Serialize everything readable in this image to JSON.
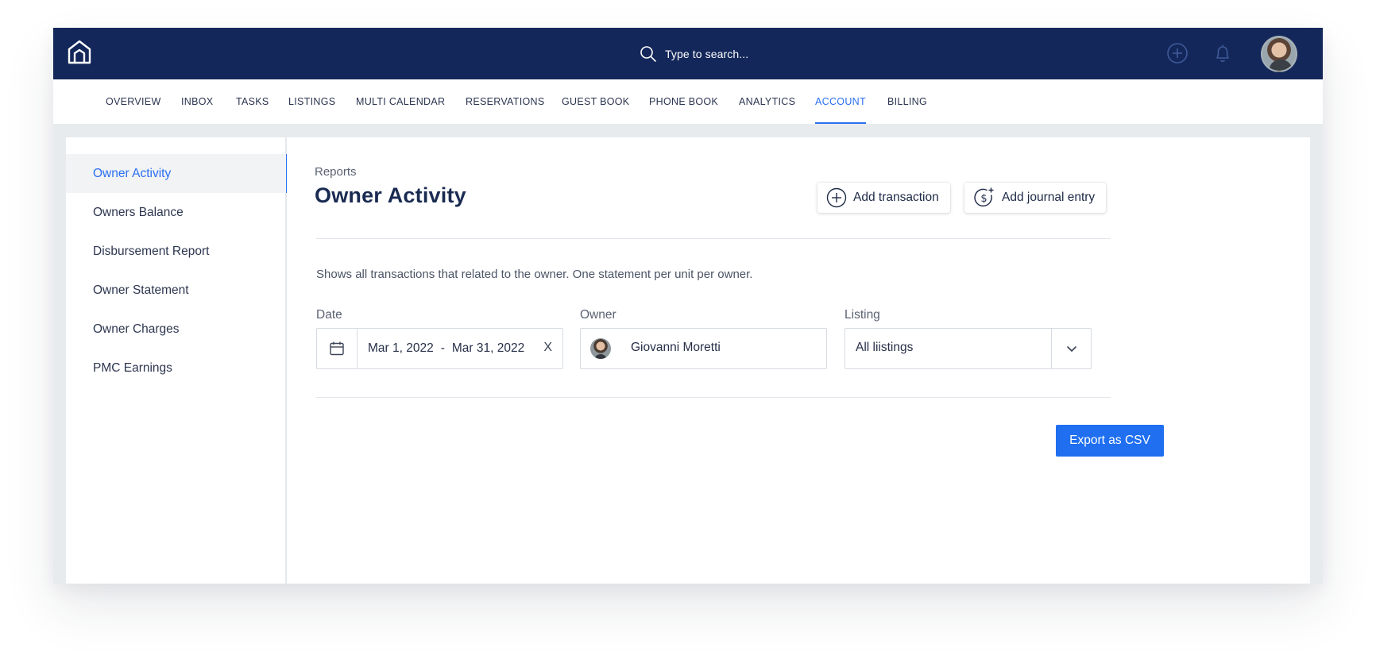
{
  "topbar": {
    "logo_icon": "house-logo-icon",
    "search_placeholder": "Type to search...",
    "search_icon": "search-icon",
    "add_icon": "plus-circle-icon",
    "notifications_icon": "bell-icon",
    "avatar_icon": "user-avatar"
  },
  "nav": {
    "items": [
      {
        "label": "OVERVIEW"
      },
      {
        "label": "INBOX"
      },
      {
        "label": "TASKS"
      },
      {
        "label": "LISTINGS"
      },
      {
        "label": "MULTI CALENDAR"
      },
      {
        "label": "RESERVATIONS"
      },
      {
        "label": "GUEST BOOK"
      },
      {
        "label": "PHONE BOOK"
      },
      {
        "label": "ANALYTICS"
      },
      {
        "label": "ACCOUNT"
      },
      {
        "label": "BILLING"
      }
    ],
    "active": "ACCOUNT"
  },
  "sidebar": {
    "items": [
      {
        "label": "Owner Activity"
      },
      {
        "label": "Owners Balance"
      },
      {
        "label": "Disbursement Report"
      },
      {
        "label": "Owner Statement"
      },
      {
        "label": "Owner Charges"
      },
      {
        "label": "PMC Earnings"
      }
    ],
    "active": "Owner Activity"
  },
  "main": {
    "breadcrumb": "Reports",
    "title": "Owner Activity",
    "actions": {
      "add_transaction": "Add transaction",
      "add_journal_entry": "Add journal entry"
    },
    "description": "Shows all transactions that related to the owner. One statement per unit per owner.",
    "filters": {
      "date": {
        "label": "Date",
        "start": "Mar 1, 2022",
        "separator": "-",
        "end": "Mar 31, 2022",
        "clear": "X"
      },
      "owner": {
        "label": "Owner",
        "value": "Giovanni Moretti"
      },
      "listing": {
        "label": "Listing",
        "value": "All liistings"
      }
    },
    "export_label": "Export as CSV"
  },
  "colors": {
    "topbar": "#13275a",
    "accent": "#2a6ff0",
    "primary_button": "#1f6ff0",
    "page_bg": "#e7ebee"
  }
}
